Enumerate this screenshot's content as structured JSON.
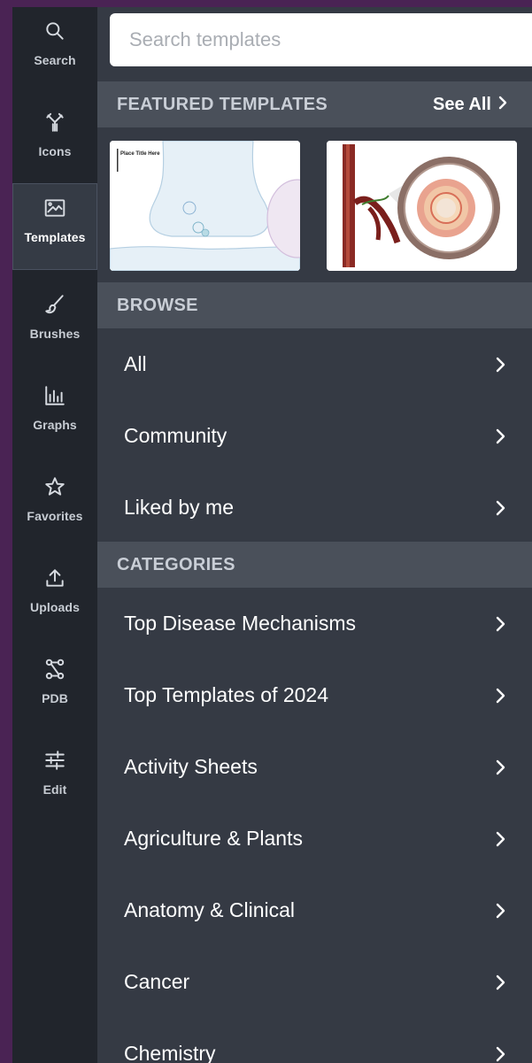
{
  "search": {
    "placeholder": "Search templates"
  },
  "rail": {
    "items": [
      {
        "label": "Search",
        "icon": "search-icon"
      },
      {
        "label": "Icons",
        "icon": "antibody-icon"
      },
      {
        "label": "Templates",
        "icon": "image-frame-icon",
        "active": true
      },
      {
        "label": "Brushes",
        "icon": "brush-icon"
      },
      {
        "label": "Graphs",
        "icon": "bar-graph-icon"
      },
      {
        "label": "Favorites",
        "icon": "star-icon"
      },
      {
        "label": "Uploads",
        "icon": "upload-icon"
      },
      {
        "label": "PDB",
        "icon": "molecule-icon"
      },
      {
        "label": "Edit",
        "icon": "sliders-icon"
      }
    ]
  },
  "featured": {
    "title": "FEATURED TEMPLATES",
    "see_all": "See All",
    "thumb1_title": "Place Title Here"
  },
  "browse": {
    "title": "BROWSE",
    "items": [
      "All",
      "Community",
      "Liked by me"
    ]
  },
  "categories": {
    "title": "CATEGORIES",
    "items": [
      "Top Disease Mechanisms",
      "Top Templates of 2024",
      "Activity Sheets",
      "Agriculture & Plants",
      "Anatomy & Clinical",
      "Cancer",
      "Chemistry"
    ]
  },
  "colors": {
    "background_purple": "#4a2354",
    "rail": "#21252c",
    "panel": "#353a44",
    "section_header": "#4a505a"
  }
}
